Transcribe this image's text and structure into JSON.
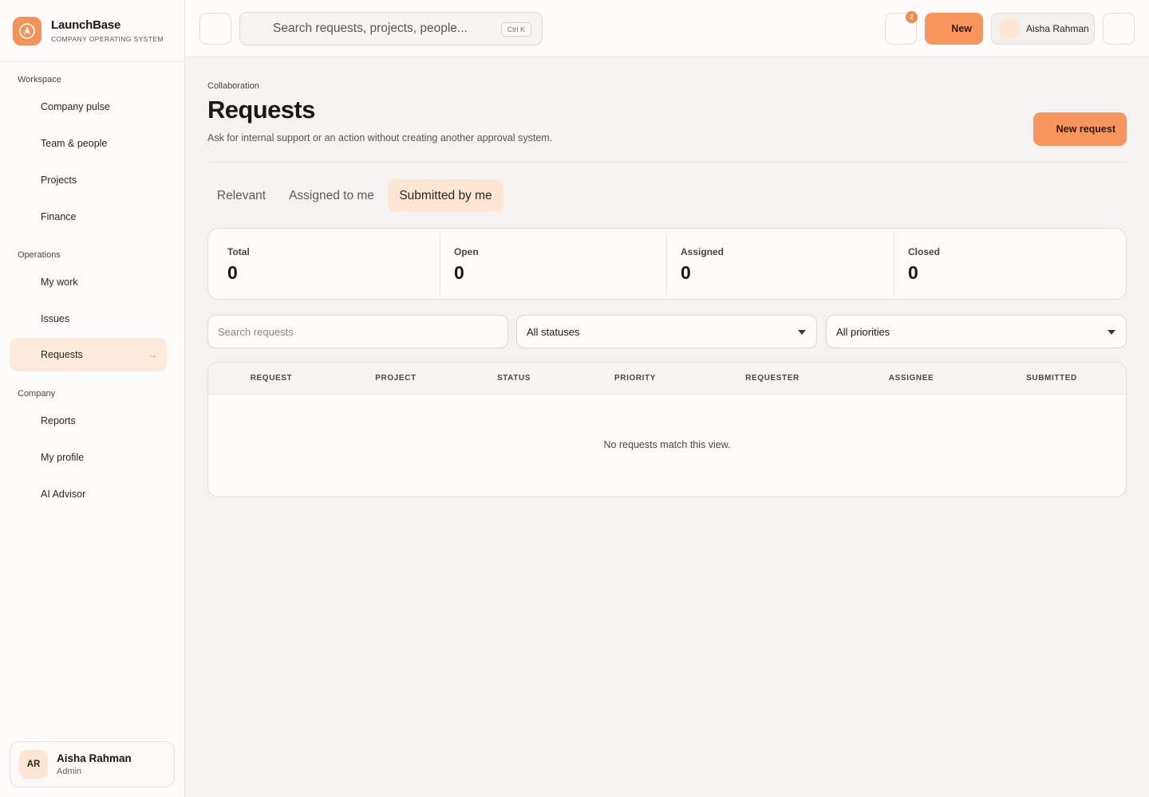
{
  "brand": {
    "name": "LaunchBase",
    "subtitle": "COMPANY OPERATING SYSTEM",
    "accent": "#f3925a"
  },
  "sidebar": {
    "sections": [
      {
        "label": "Workspace",
        "items": [
          {
            "label": "Company pulse",
            "active": false
          },
          {
            "label": "Team & people",
            "active": false
          },
          {
            "label": "Projects",
            "active": false
          },
          {
            "label": "Finance",
            "active": false
          }
        ]
      },
      {
        "label": "Operations",
        "items": [
          {
            "label": "My work",
            "active": false
          },
          {
            "label": "Issues",
            "active": false
          },
          {
            "label": "Requests",
            "active": true,
            "arrow": "→"
          }
        ]
      },
      {
        "label": "Company",
        "items": [
          {
            "label": "Reports",
            "active": false
          },
          {
            "label": "My profile",
            "active": false
          },
          {
            "label": "AI Advisor",
            "active": false
          }
        ]
      }
    ],
    "user": {
      "initials": "AR",
      "name": "Aisha Rahman",
      "role": "Admin"
    }
  },
  "topbar": {
    "search_placeholder": "Search requests, projects, people...",
    "search_shortcut": "Ctrl K",
    "notification_count": "2",
    "new_label": "New",
    "profile_name": "Aisha Rahman"
  },
  "page": {
    "breadcrumb": "Collaboration",
    "title": "Requests",
    "description": "Ask for internal support or an action without creating another approval system.",
    "new_request_label": "New request"
  },
  "tabs": [
    {
      "label": "Relevant",
      "active": false
    },
    {
      "label": "Assigned to me",
      "active": false
    },
    {
      "label": "Submitted by me",
      "active": true
    }
  ],
  "stats": [
    {
      "label": "Total",
      "value": "0"
    },
    {
      "label": "Open",
      "value": "0"
    },
    {
      "label": "Assigned",
      "value": "0"
    },
    {
      "label": "Closed",
      "value": "0"
    }
  ],
  "filters": {
    "search_placeholder": "Search requests",
    "status_value": "All statuses",
    "priority_value": "All priorities"
  },
  "table": {
    "columns": [
      "REQUEST",
      "PROJECT",
      "STATUS",
      "PRIORITY",
      "REQUESTER",
      "ASSIGNEE",
      "SUBMITTED"
    ],
    "rows": [],
    "empty_message": "No requests match this view."
  },
  "colors": {
    "accent": "#f7955d",
    "active_bg": "#fdeadb",
    "background": "#f4f3f1",
    "surface": "#fdfcfb"
  }
}
